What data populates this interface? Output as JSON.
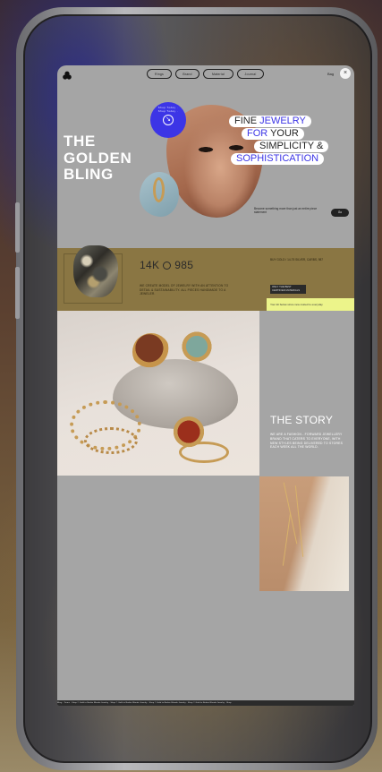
{
  "nav": {
    "items": [
      "Rings",
      "Brand",
      "Material",
      "Journal"
    ],
    "bag_label": "Bag",
    "close_glyph": "×"
  },
  "hero": {
    "title_lines": [
      "THE",
      "GOLDEN",
      "BLING"
    ],
    "tagline": {
      "line1_plain": "FINE ",
      "line1_accent": "JEWELRY",
      "line2_accent": "FOR",
      "line2_plain": " YOUR",
      "line3": "SIMPLICITY &",
      "line4": "SOPHISTICATION"
    },
    "badge_text": "Shop Today · Shop Today ·",
    "badge_glyph": "↘",
    "subtext": "Become something more than just an entire piece statement",
    "button_label": "Go",
    "accent_color": "#3c35e6"
  },
  "gold_band": {
    "purity_left": "14K",
    "purity_right": "985",
    "copy": "WE CREATE MODEL OF JEWELRY WITH AN ATTENTION TO DETAIL & SUSTAINABILITY. ALL PIECES HANDMADE TO A JEWELER.",
    "note": "BUY GOLD / 14-75 SILVER, CARBS, 987",
    "cert_tag": "ONLY THE BEST CERTIFIED MATERIALS",
    "yellow_bar_text": "Your kit below since new costed to everyday",
    "band_color": "#8a7643"
  },
  "story": {
    "title": "THE STORY",
    "copy": "WE ARE A FASHION - FORWARD JEWELLERY BRAND THAT CATERS TO EVERYONE, WITH NEW STYLES BEING DELIVERED TO STORES EACH WEEK ALL THE WORLD."
  },
  "footer": {
    "text": "Bling · Terms · Shop © Gold to Barbie Blonde Jewelry · Shop © Gold to Barbie Blonde Jewelry · Shop © Gold to Barbie Blonde Jewelry · Shop © Gold to Barbie Blonde Jewelry · Shop"
  }
}
